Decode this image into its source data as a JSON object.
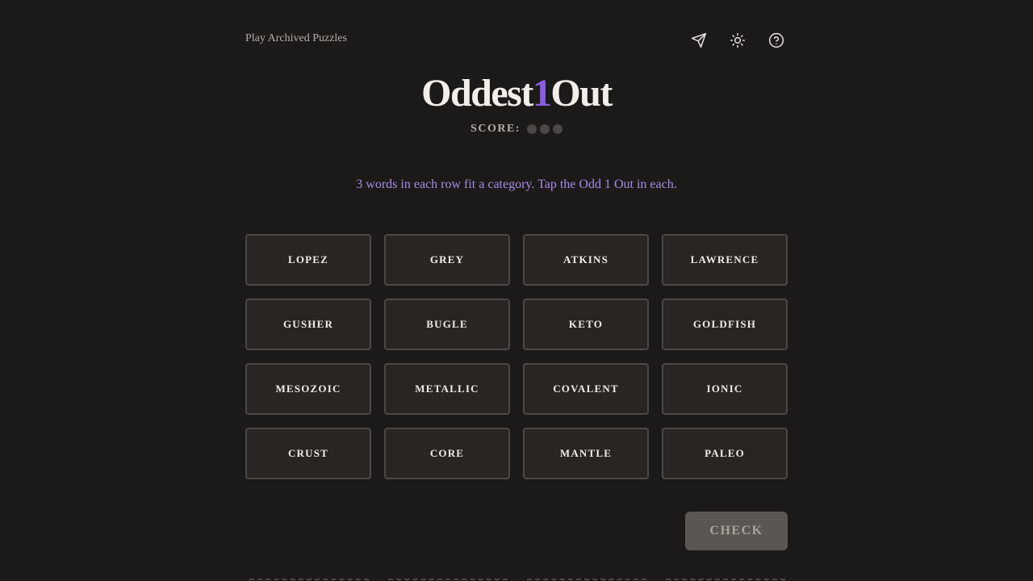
{
  "header": {
    "archive_link": "Play Archived Puzzles",
    "icons": [
      "send-icon",
      "sun-icon",
      "help-icon"
    ]
  },
  "title": {
    "part1": "Oddest",
    "accent": "1",
    "part2": "Out",
    "accent_color": "#8a5ce6"
  },
  "score": {
    "label": "SCORE:",
    "dots_total": 3,
    "dots_filled": 0
  },
  "instructions": "3 words in each row fit a category. Tap the Odd 1 Out in each.",
  "grid": {
    "rows": [
      [
        "LOPEZ",
        "GREY",
        "ATKINS",
        "LAWRENCE"
      ],
      [
        "GUSHER",
        "BUGLE",
        "KETO",
        "GOLDFISH"
      ],
      [
        "MESOZOIC",
        "METALLIC",
        "COVALENT",
        "IONIC"
      ],
      [
        "CRUST",
        "CORE",
        "MANTLE",
        "PALEO"
      ]
    ]
  },
  "check_button": "CHECK"
}
